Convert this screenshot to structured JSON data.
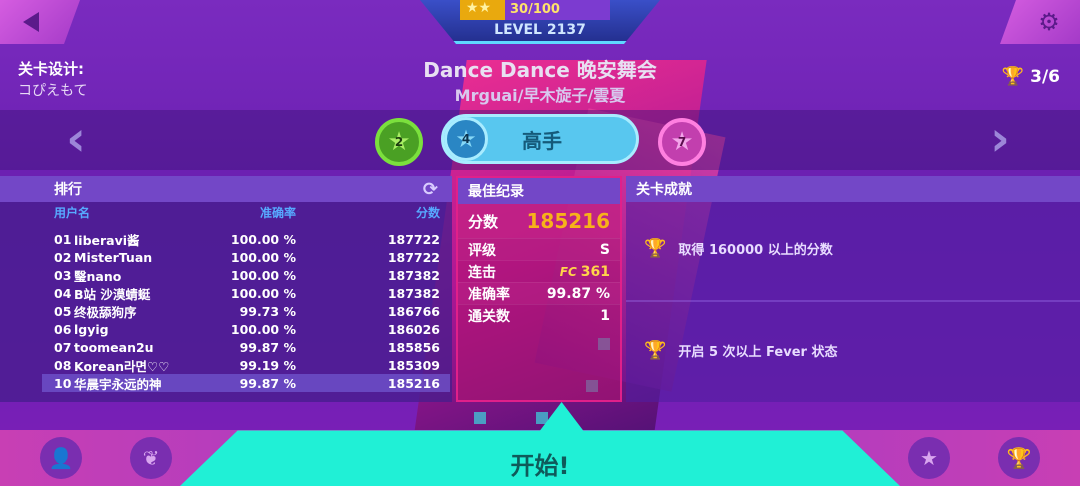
{
  "topbar": {
    "progress_text": "30/100",
    "progress_fraction": 0.3,
    "progress_stars": "★★",
    "level": "LEVEL 2137",
    "back_icon": "back-arrow-icon",
    "settings_icon": "gear-icon"
  },
  "level_info": {
    "designer_label": "关卡设计:",
    "designer_name": "コぴえもて",
    "song_title": "Dance Dance 晚安舞会",
    "song_artist": "Mrguai/早木旋子/雲夏",
    "trophies": "3/6"
  },
  "difficulty": {
    "easy_level": "2",
    "selected_level": "4",
    "selected_label": "高手",
    "hard_level": "7"
  },
  "leaderboard": {
    "title": "排行",
    "col_user": "用户名",
    "col_accuracy": "准确率",
    "col_score": "分数",
    "rows": [
      {
        "rank": "01",
        "name": "liberavi酱",
        "accuracy": "100.00 %",
        "score": "187722"
      },
      {
        "rank": "02",
        "name": "MisterTuan",
        "accuracy": "100.00 %",
        "score": "187722"
      },
      {
        "rank": "03",
        "name": "瑿nano",
        "accuracy": "100.00 %",
        "score": "187382"
      },
      {
        "rank": "04",
        "name": "B站 沙漠蜻蜓",
        "accuracy": "100.00 %",
        "score": "187382"
      },
      {
        "rank": "05",
        "name": "终极舔狗序",
        "accuracy": "99.73 %",
        "score": "186766"
      },
      {
        "rank": "06",
        "name": "lgyig",
        "accuracy": "100.00 %",
        "score": "186026"
      },
      {
        "rank": "07",
        "name": "toomean2u",
        "accuracy": "99.87 %",
        "score": "185856"
      },
      {
        "rank": "08",
        "name": "Korean라면♡♡",
        "accuracy": "99.19 %",
        "score": "185309"
      }
    ],
    "me": {
      "rank": "10",
      "name": "华晨宇永远的神",
      "accuracy": "99.87 %",
      "score": "185216"
    }
  },
  "best": {
    "title": "最佳纪录",
    "score_label": "分数",
    "score_value": "185216",
    "grade_label": "评级",
    "grade_value": "S",
    "combo_label": "连击",
    "combo_badge": "FC",
    "combo_value": "361",
    "accuracy_label": "准确率",
    "accuracy_value": "99.87 %",
    "clears_label": "通关数",
    "clears_value": "1"
  },
  "achievements": {
    "title": "关卡成就",
    "items": [
      "取得 160000 以上的分数",
      "开启 5 次以上 Fever 状态"
    ]
  },
  "bottom": {
    "start_label": "开始!",
    "left_icons": [
      "profile-icon",
      "leaf-icon"
    ],
    "right_icons": [
      "star-icon",
      "trophy-icon"
    ]
  },
  "colors": {
    "accent_cyan": "#20f0d6",
    "score_gold": "#f7b21a",
    "selected_pill": "#58c7ef"
  }
}
